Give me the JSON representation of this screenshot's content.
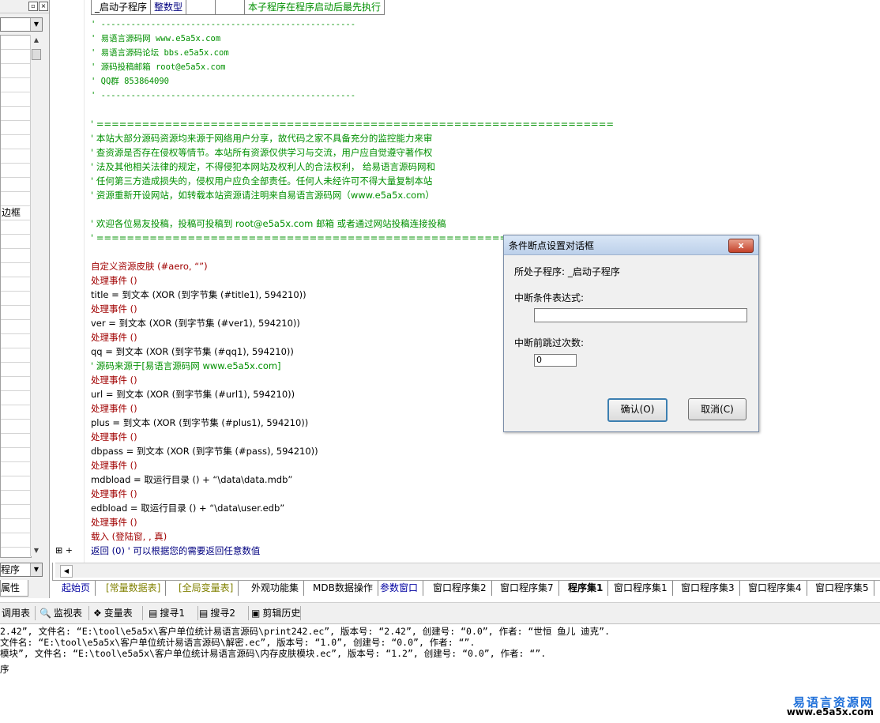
{
  "left_panel": {
    "prop_rows": [
      "",
      "",
      "",
      "",
      "",
      "",
      "",
      "",
      "",
      "",
      "",
      "",
      "边框",
      "",
      "",
      "",
      "",
      "",
      "",
      "",
      "",
      "",
      "",
      "",
      "",
      "",
      "",
      "",
      "",
      "",
      "",
      "",
      "",
      "",
      "",
      "",
      "",
      "",
      ""
    ],
    "bottom_combo_value": "程序",
    "tab_label": "属性"
  },
  "editor": {
    "table_row": [
      "_启动子程序",
      "整数型",
      "",
      "",
      "本子程序在程序启动后最先执行"
    ],
    "comment_block_1": [
      "' ---------------------------------------------------",
      "' 易语言源码网    www.e5a5x.com",
      "' 易语言源码论坛    bbs.e5a5x.com",
      "' 源码投稿邮箱  root@e5a5x.com",
      "' QQ群    853864090",
      "' ---------------------------------------------------"
    ],
    "comment_block_2": [
      "' ====================================================================",
      "' 本站大部分源码资源均来源于网络用户分享，故代码之家不具备充分的监控能力来审",
      "' 查资源是否存在侵权等情节。本站所有资源仅供学习与交流，用户应自觉遵守著作权",
      "' 法及其他相关法律的规定，不得侵犯本网站及权利人的合法权利， 给易语言源码网和",
      "' 任何第三方造成损失的，侵权用户应负全部责任。任何人未经许可不得大量复制本站",
      "' 资源重新开设网站，如转载本站资源请注明来自易语言源码网（www.e5a5x.com）",
      "",
      "' 欢迎各位易友投稿，投稿可投稿到   root@e5a5x.com  邮箱 或者通过网站投稿连接投稿",
      "' ===================================================================="
    ],
    "code_lines": [
      {
        "text": "自定义资源皮肤 (#aero, “”)",
        "cls": "kw"
      },
      {
        "text": "处理事件 ()",
        "cls": "kw"
      },
      {
        "text": "title = 到文本 (XOR (到字节集 (#title1), 594210))",
        "cls": "plain"
      },
      {
        "text": "处理事件 ()",
        "cls": "kw"
      },
      {
        "text": "ver = 到文本 (XOR (到字节集 (#ver1), 594210))",
        "cls": "plain"
      },
      {
        "text": "处理事件 ()",
        "cls": "kw"
      },
      {
        "text": "qq = 到文本 (XOR (到字节集 (#qq1), 594210))",
        "cls": "plain"
      },
      {
        "text": "' 源码来源于[易语言源码网 www.e5a5x.com]",
        "cls": "cmt"
      },
      {
        "text": "处理事件 ()",
        "cls": "kw"
      },
      {
        "text": "url = 到文本 (XOR (到字节集 (#url1), 594210))",
        "cls": "plain"
      },
      {
        "text": "处理事件 ()",
        "cls": "kw"
      },
      {
        "text": "plus = 到文本 (XOR (到字节集 (#plus1), 594210))",
        "cls": "plain"
      },
      {
        "text": "处理事件 ()",
        "cls": "kw"
      },
      {
        "text": "dbpass = 到文本 (XOR (到字节集 (#pass), 594210))",
        "cls": "plain"
      },
      {
        "text": "处理事件 ()",
        "cls": "kw"
      },
      {
        "text": "mdbload = 取运行目录 () + “\\data\\data.mdb”",
        "cls": "plain"
      },
      {
        "text": "处理事件 ()",
        "cls": "kw"
      },
      {
        "text": "edbload = 取运行目录 () + “\\data\\user.edb”",
        "cls": "plain"
      },
      {
        "text": "处理事件 ()",
        "cls": "kw"
      },
      {
        "text": "载入 (登陆窗, , 真)",
        "cls": "kw"
      },
      {
        "text": "返回 (0)  ' 可以根据您的需要返回任意数值",
        "cls": "fn"
      }
    ]
  },
  "tabs": [
    {
      "label": "起始页",
      "style": "blue"
    },
    {
      "label": "[常量数据表]",
      "style": "olive"
    },
    {
      "label": "[全局变量表]",
      "style": "olive"
    },
    {
      "label": "外观功能集",
      "style": ""
    },
    {
      "label": "MDB数据操作",
      "style": ""
    },
    {
      "label": "参数窗口",
      "style": "blue"
    },
    {
      "label": "窗口程序集2",
      "style": ""
    },
    {
      "label": "窗口程序集7",
      "style": ""
    },
    {
      "label": "程序集1",
      "style": "bold"
    },
    {
      "label": "窗口程序集1",
      "style": ""
    },
    {
      "label": "窗口程序集3",
      "style": ""
    },
    {
      "label": "窗口程序集4",
      "style": ""
    },
    {
      "label": "窗口程序集5",
      "style": ""
    }
  ],
  "toolbar": {
    "items": [
      {
        "label": "调用表",
        "icon": ""
      },
      {
        "label": "监视表",
        "icon": "🔍"
      },
      {
        "label": "变量表",
        "icon": "❖"
      },
      {
        "label": "搜寻1",
        "icon": "▤"
      },
      {
        "label": "搜寻2",
        "icon": "▤"
      },
      {
        "label": "剪辑历史",
        "icon": "▣"
      }
    ]
  },
  "output": {
    "lines": [
      "2.42”, 文件名: “E:\\tool\\e5a5x\\客户单位统计易语言源码\\print242.ec”, 版本号: “2.42”, 创建号: “0.0”, 作者: “世恒  鱼儿  迪克”.",
      "文件名: “E:\\tool\\e5a5x\\客户单位统计易语言源码\\解密.ec”, 版本号: “1.0”, 创建号: “0.0”, 作者: “”.",
      "模块”, 文件名: “E:\\tool\\e5a5x\\客户单位统计易语言源码\\内存皮肤模块.ec”, 版本号: “1.2”, 创建号: “0.0”, 作者: “”.",
      "",
      "序"
    ],
    "watermark_cn": "易语言资源网",
    "watermark_url": "www.e5a5x.com"
  },
  "dialog": {
    "title": "条件断点设置对话框",
    "close_label": "x",
    "subprogram_label": "所处子程序: _启动子程序",
    "expr_label": "中断条件表达式:",
    "expr_value": "",
    "skip_label": "中断前跳过次数:",
    "skip_value": "0",
    "ok_label": "确认(O)",
    "cancel_label": "取消(C)"
  },
  "colors": {
    "comment": "#009000",
    "keyword": "#a00000",
    "dialog_close": "#c4422b",
    "watermark": "#1e6fd9"
  }
}
